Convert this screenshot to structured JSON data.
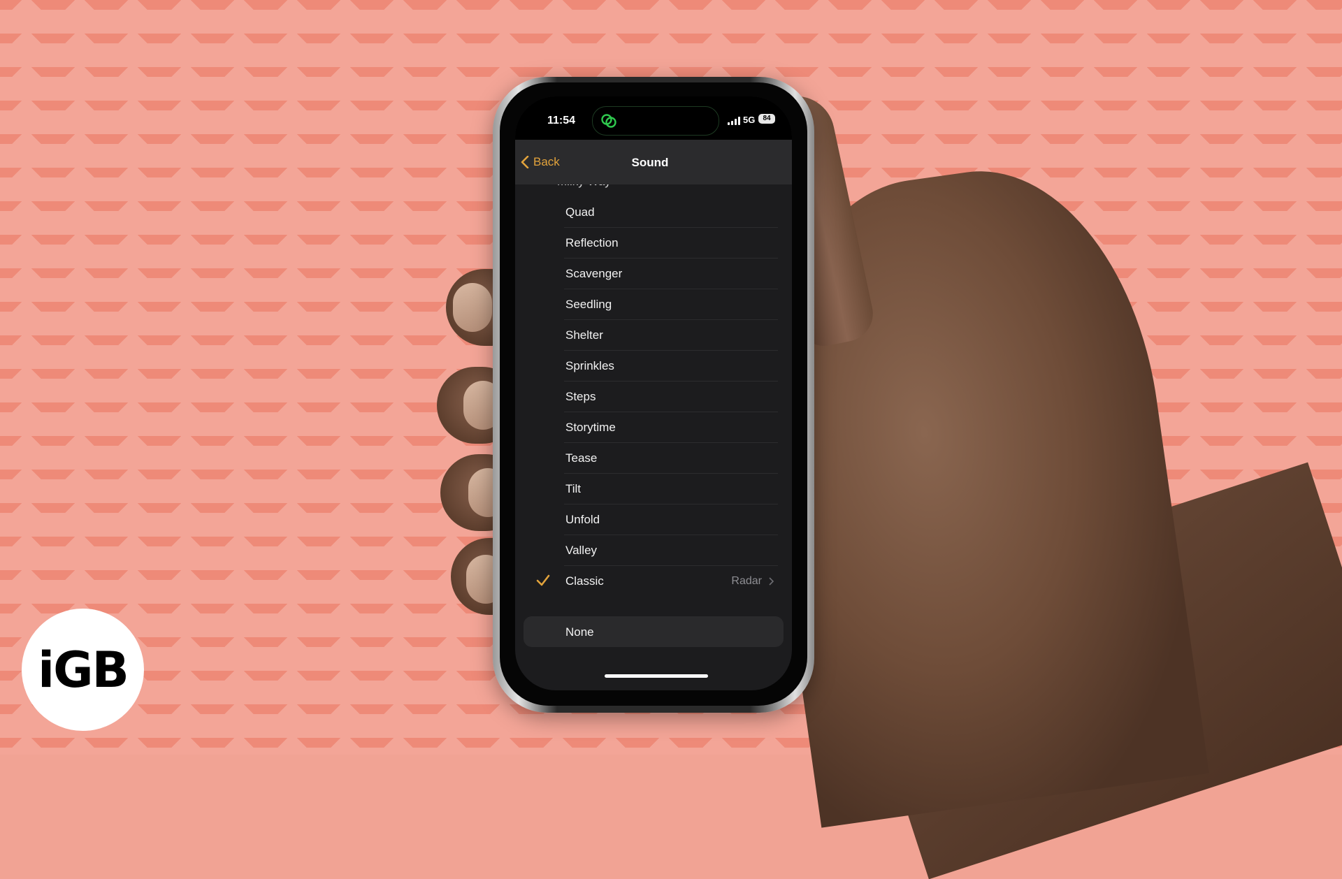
{
  "status_bar": {
    "time": "11:54",
    "network": "5G",
    "battery": "84",
    "dynamic_island_icon": "link-chain-icon",
    "signal_bars": 4
  },
  "nav": {
    "back_label": "Back",
    "title": "Sound"
  },
  "sound_list": {
    "partial_top_item": "Milky Way",
    "items": [
      {
        "label": "Quad"
      },
      {
        "label": "Reflection"
      },
      {
        "label": "Scavenger"
      },
      {
        "label": "Seedling"
      },
      {
        "label": "Shelter"
      },
      {
        "label": "Sprinkles"
      },
      {
        "label": "Steps"
      },
      {
        "label": "Storytime"
      },
      {
        "label": "Tease"
      },
      {
        "label": "Tilt"
      },
      {
        "label": "Unfold"
      },
      {
        "label": "Valley"
      }
    ],
    "selected": {
      "label": "Classic",
      "detail": "Radar",
      "checked": true
    }
  },
  "none_option": {
    "label": "None"
  },
  "branding": {
    "logo_text": "iGB"
  },
  "colors": {
    "accent": "#e2a33c",
    "background": "#f3a597",
    "pattern": "#ee8a78",
    "screen_bg": "#1c1c1e",
    "island_glow": "#2fc94e"
  }
}
